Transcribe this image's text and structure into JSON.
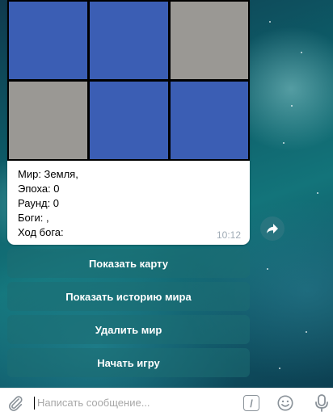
{
  "colors": {
    "grid_blue": "#3b5eb4",
    "grid_gray": "#9a9894",
    "grid_border": "#000000",
    "button_text": "#ffffff",
    "time_text": "#a0acb6",
    "placeholder_text": "#a7a7a7"
  },
  "message": {
    "grid": [
      "blue",
      "blue",
      "gray",
      "gray",
      "blue",
      "blue"
    ],
    "lines": [
      "Мир: Земля,",
      "Эпоха: 0",
      "Раунд: 0",
      "Боги: ,",
      "Ход бога:"
    ],
    "time": "10:12"
  },
  "keyboard": {
    "buttons": [
      "Показать карту",
      "Показать историю мира",
      "Удалить мир",
      "Начать игру"
    ]
  },
  "input": {
    "placeholder": "Написать сообщение...",
    "commands_label": "/"
  },
  "icons": {
    "attach": "paperclip-icon",
    "share": "forward-arrow-icon",
    "commands": "slash-command-icon",
    "emoji": "emoji-smile-icon",
    "voice": "microphone-icon"
  }
}
